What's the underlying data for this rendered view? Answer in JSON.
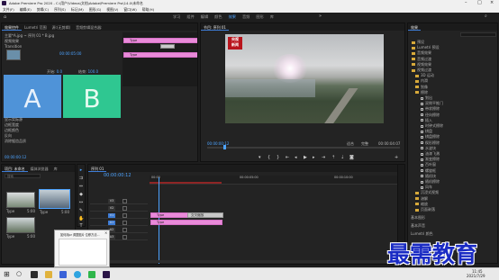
{
  "window": {
    "title": "Adobe Premiere Pro 2020 - C:\\用户\\Videos\\文档\\Adobe\\Premiere Pro\\14.0\\未命名",
    "menu": [
      "文件(F)",
      "编辑(E)",
      "剪辑(C)",
      "序列(S)",
      "标记(M)",
      "图形(G)",
      "视图(V)",
      "窗口(W)",
      "帮助(H)"
    ]
  },
  "workspaces": [
    "学习",
    "组件",
    "编辑",
    "颜色",
    "效果",
    "音频",
    "图形",
    "库"
  ],
  "workspace_active": "效果",
  "effect_controls": {
    "tabs": [
      "效果控件",
      "Lumetri 范围",
      "源:(无剪辑)",
      "音频剪辑混合器:"
    ],
    "header": "主要*A.jpg ~ 序列 01 * B.jpg",
    "clip_label": "Type",
    "rows": [
      "视频效果",
      "Transition",
      "显示实际源",
      "开始: 0.0",
      "结束: 100.0",
      "边框宽度",
      "边框颜色",
      "反向",
      "消除锯齿品质"
    ],
    "start_value": "0.0",
    "end_value": "100.0",
    "timecode_top": "00:00:05:00",
    "label_a": "A",
    "label_b": "B",
    "bottom_timecode": "00:00:00:12"
  },
  "program": {
    "tab": "节目: 序列 01",
    "timecode_left": "00:00:00:12",
    "timecode_right": "00:00:04:07",
    "fit": "适合",
    "quality": "完整",
    "logo_line1": "央视",
    "logo_line2": "新闻"
  },
  "project": {
    "tabs": [
      "项目: 未命名",
      "媒体浏览器",
      "库"
    ],
    "search_placeholder": "搜索",
    "items": [
      {
        "name": "Type",
        "duration": "5:00"
      },
      {
        "name": "Type",
        "duration": "5:00"
      },
      {
        "name": "Type",
        "duration": "5:00"
      }
    ]
  },
  "timeline": {
    "tab": "序列 01",
    "timecode": "00:00:00:12",
    "ruler": [
      "00:00",
      "00:00:05:00",
      "00:00:10:00"
    ],
    "tracks": [
      "V3",
      "V2",
      "V1",
      "A1",
      "A2",
      "A3"
    ],
    "clips": [
      {
        "label": "Type"
      },
      {
        "label": "Type"
      },
      {
        "label": "Type"
      }
    ],
    "transition_label": "交叉缩放"
  },
  "effects": {
    "tab": "效果",
    "items": [
      {
        "label": "预设",
        "kind": "folder"
      },
      {
        "label": "Lumetri 预设",
        "kind": "folder"
      },
      {
        "label": "音频效果",
        "kind": "folder"
      },
      {
        "label": "音频过渡",
        "kind": "folder"
      },
      {
        "label": "视频效果",
        "kind": "folder"
      },
      {
        "label": "视频过渡",
        "kind": "folder"
      },
      {
        "label": "3D 运动",
        "kind": "folder"
      },
      {
        "label": "内滑",
        "kind": "folder"
      },
      {
        "label": "划像",
        "kind": "folder"
      },
      {
        "label": "擦除",
        "kind": "folder"
      },
      {
        "label": "划出",
        "kind": "fx"
      },
      {
        "label": "双侧平推门",
        "kind": "fx"
      },
      {
        "label": "带状擦除",
        "kind": "fx"
      },
      {
        "label": "径向擦除",
        "kind": "fx"
      },
      {
        "label": "插入",
        "kind": "fx"
      },
      {
        "label": "时钟式擦除",
        "kind": "fx"
      },
      {
        "label": "棋盘",
        "kind": "fx"
      },
      {
        "label": "棋盘擦除",
        "kind": "fx"
      },
      {
        "label": "楔形擦除",
        "kind": "fx"
      },
      {
        "label": "水波块",
        "kind": "fx"
      },
      {
        "label": "油漆飞溅",
        "kind": "fx"
      },
      {
        "label": "渐变擦除",
        "kind": "fx"
      },
      {
        "label": "百叶窗",
        "kind": "fx"
      },
      {
        "label": "螺旋框",
        "kind": "fx"
      },
      {
        "label": "随机块",
        "kind": "fx"
      },
      {
        "label": "随机擦除",
        "kind": "fx"
      },
      {
        "label": "风车",
        "kind": "fx"
      },
      {
        "label": "沉浸式视频",
        "kind": "folder"
      },
      {
        "label": "溶解",
        "kind": "folder"
      },
      {
        "label": "缩放",
        "kind": "folder"
      },
      {
        "label": "页面剥落",
        "kind": "folder"
      }
    ],
    "bottom": [
      "基本图形",
      "基本声音",
      "Lumetri 颜色"
    ]
  },
  "popup": {
    "title": "如何用pr 调整图片 位移方法...",
    "items": [
      "",
      "",
      ""
    ]
  },
  "taskbar": {
    "time": "11:45",
    "date": "2021/7/29"
  },
  "watermark": "最需教育",
  "colors": {
    "accent_blue": "#4da3ff",
    "clip_pink": "#e98ad9",
    "a_panel": "#4f93d8",
    "b_panel": "#2fc791",
    "watermark": "#1a2bc4"
  }
}
